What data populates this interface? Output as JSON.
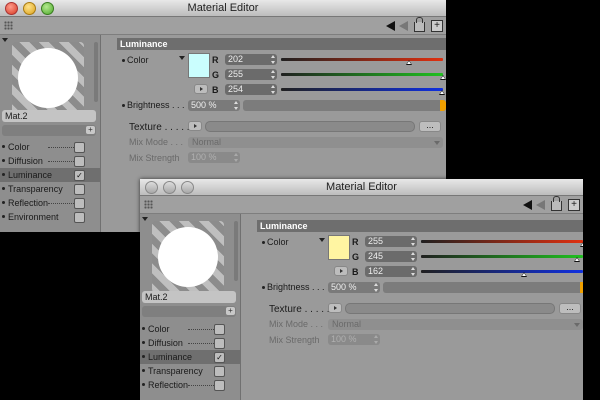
{
  "windows": [
    {
      "title": "Material Editor",
      "material_name": "Mat.2",
      "channels": [
        {
          "label": "Color",
          "checked": false,
          "selected": false
        },
        {
          "label": "Diffusion",
          "checked": false,
          "selected": false
        },
        {
          "label": "Luminance",
          "checked": true,
          "selected": true
        },
        {
          "label": "Transparency",
          "checked": false,
          "selected": false
        },
        {
          "label": "Reflection",
          "checked": false,
          "selected": false
        },
        {
          "label": "Environment",
          "checked": false,
          "selected": false
        }
      ],
      "section_title": "Luminance",
      "color_label": "Color",
      "swatch_color": "#cafefe",
      "r_label": "R",
      "g_label": "G",
      "b_label": "B",
      "r": 202,
      "g": 255,
      "b": 254,
      "r_text": "202",
      "g_text": "255",
      "b_text": "254",
      "brightness_label": "Brightness",
      "brightness_value": "500 %",
      "texture_label": "Texture",
      "ellipsis": "...",
      "mix_mode_label": "Mix Mode",
      "mix_mode_value": "Normal",
      "mix_strength_label": "Mix Strength",
      "mix_strength_value": "100 %"
    },
    {
      "title": "Material Editor",
      "material_name": "Mat.2",
      "channels": [
        {
          "label": "Color",
          "checked": false,
          "selected": false
        },
        {
          "label": "Diffusion",
          "checked": false,
          "selected": false
        },
        {
          "label": "Luminance",
          "checked": true,
          "selected": true
        },
        {
          "label": "Transparency",
          "checked": false,
          "selected": false
        },
        {
          "label": "Reflection",
          "checked": false,
          "selected": false
        }
      ],
      "section_title": "Luminance",
      "color_label": "Color",
      "swatch_color": "#fff5a2",
      "r_label": "R",
      "g_label": "G",
      "b_label": "B",
      "r": 255,
      "g": 245,
      "b": 162,
      "r_text": "255",
      "g_text": "245",
      "b_text": "162",
      "brightness_label": "Brightness",
      "brightness_value": "500 %",
      "texture_label": "Texture",
      "ellipsis": "...",
      "mix_mode_label": "Mix Mode",
      "mix_mode_value": "Normal",
      "mix_strength_label": "Mix Strength",
      "mix_strength_value": "100 %"
    }
  ],
  "colors": {
    "window_bg": "#9a9a9a",
    "section_bg": "#6e6e6e",
    "brightness_accent": "#f0a000",
    "red_slider": "#e03010",
    "green_slider": "#20c020",
    "blue_slider": "#1030e0"
  }
}
